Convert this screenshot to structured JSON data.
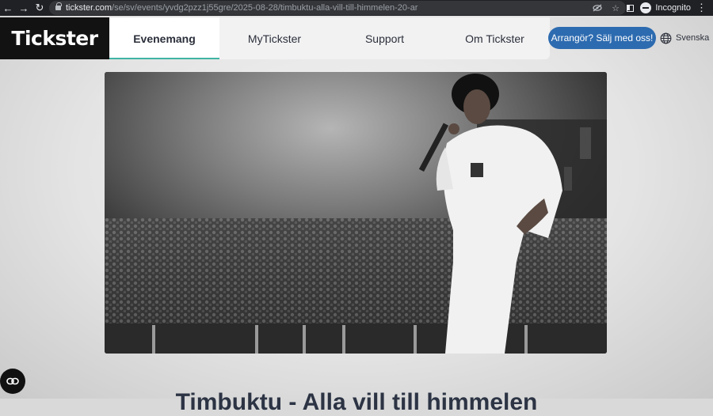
{
  "browser": {
    "url_host": "tickster.com",
    "url_path": "/se/sv/events/yvdg2pzz1j55gre/2025-08-28/timbuktu-alla-vill-till-himmelen-20-ar",
    "profile_label": "Incognito",
    "icons": [
      "back-arrow-icon",
      "forward-arrow-icon",
      "reload-icon",
      "lock-icon",
      "eye-off-icon",
      "star-icon",
      "side-panel-icon",
      "incognito-icon",
      "kebab-menu-icon"
    ]
  },
  "header": {
    "logo": "Tickster",
    "nav": [
      {
        "label": "Evenemang",
        "active": true
      },
      {
        "label": "MyTickster",
        "active": false
      },
      {
        "label": "Support",
        "active": false
      },
      {
        "label": "Om Tickster",
        "active": false
      }
    ],
    "cta_label": "Arrangör? Sälj med oss!",
    "language": "Svenska",
    "accent_color": "#40b4a4",
    "cta_color": "#2d6bb0"
  },
  "hero": {
    "image_alt": "Timbuktu performing on stage in front of a large crowd",
    "icon": "concert-photo"
  },
  "event": {
    "title": "Timbuktu - Alla vill till himmelen"
  },
  "floating_button": {
    "icon": "link-icon"
  }
}
